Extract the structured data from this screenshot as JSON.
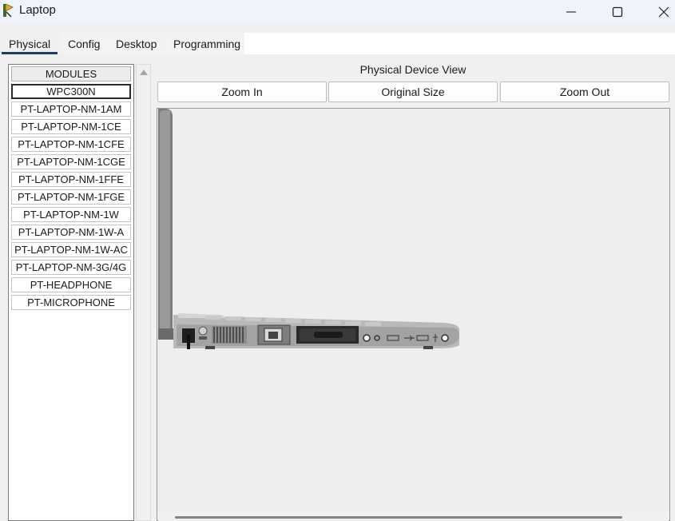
{
  "window": {
    "title": "Laptop",
    "icon": "packet-tracer-app-icon",
    "controls": [
      "minimize-icon",
      "maximize-icon",
      "close-icon"
    ]
  },
  "tabs": [
    {
      "label": "Physical",
      "active": true
    },
    {
      "label": "Config",
      "active": false
    },
    {
      "label": "Desktop",
      "active": false
    },
    {
      "label": "Programming",
      "active": false
    }
  ],
  "modules": {
    "header": "MODULES",
    "items": [
      {
        "label": "WPC300N",
        "selected": true
      },
      {
        "label": "PT-LAPTOP-NM-1AM"
      },
      {
        "label": "PT-LAPTOP-NM-1CE"
      },
      {
        "label": "PT-LAPTOP-NM-1CFE"
      },
      {
        "label": "PT-LAPTOP-NM-1CGE"
      },
      {
        "label": "PT-LAPTOP-NM-1FFE"
      },
      {
        "label": "PT-LAPTOP-NM-1FGE"
      },
      {
        "label": "PT-LAPTOP-NM-1W"
      },
      {
        "label": "PT-LAPTOP-NM-1W-A"
      },
      {
        "label": "PT-LAPTOP-NM-1W-AC"
      },
      {
        "label": "PT-LAPTOP-NM-3G/4G"
      },
      {
        "label": "PT-HEADPHONE"
      },
      {
        "label": "PT-MICROPHONE"
      }
    ]
  },
  "device_view": {
    "title": "Physical Device View",
    "zoom_in": "Zoom In",
    "original_size": "Original Size",
    "zoom_out": "Zoom Out"
  },
  "colors": {
    "tab_underline": "#1f3b63",
    "canvas_bg": "#eeeeee",
    "laptop_body": "#a8a8a8"
  }
}
